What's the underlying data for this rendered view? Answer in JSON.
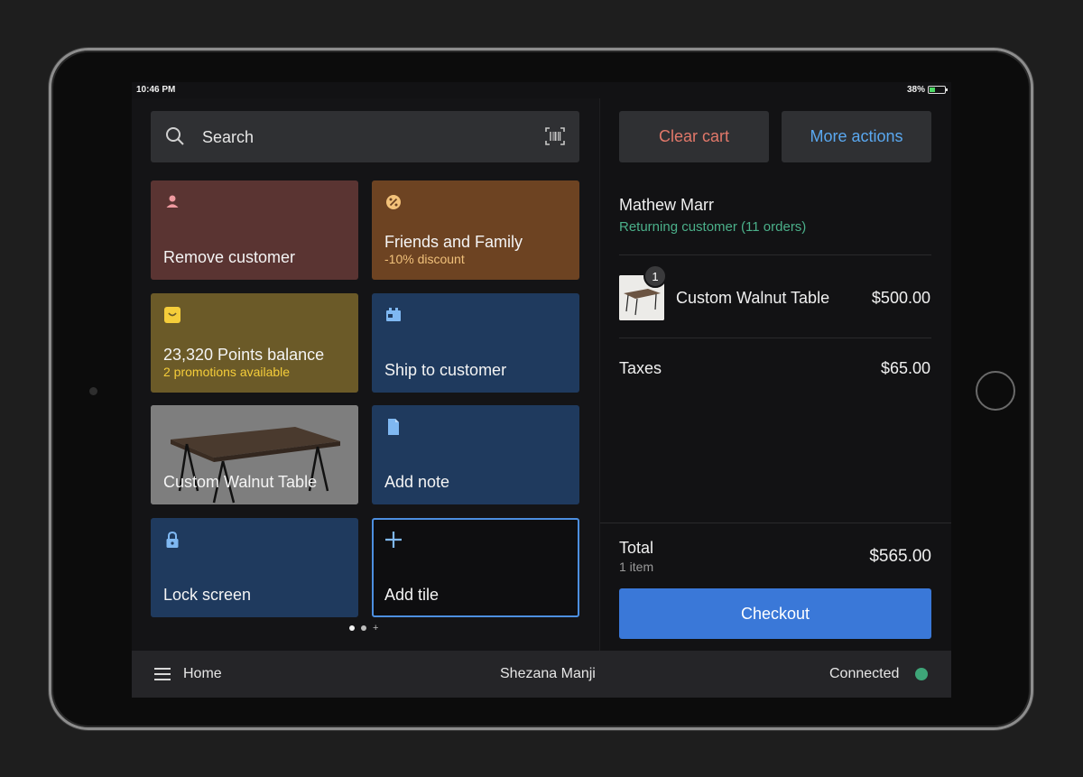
{
  "status_bar": {
    "time": "10:46 PM",
    "battery": "38%"
  },
  "search": {
    "placeholder": "Search"
  },
  "tiles": [
    {
      "label": "Remove customer",
      "sub": "",
      "icon": "person-icon"
    },
    {
      "label": "Friends and Family",
      "sub": "-10% discount",
      "icon": "discount-icon"
    },
    {
      "label": "23,320 Points balance",
      "sub": "2 promotions available",
      "icon": "reward-icon"
    },
    {
      "label": "Ship to customer",
      "sub": "",
      "icon": "shipping-icon"
    },
    {
      "label": "Custom Walnut Table",
      "sub": "",
      "icon": "table-image"
    },
    {
      "label": "Add note",
      "sub": "",
      "icon": "note-icon"
    },
    {
      "label": "Lock screen",
      "sub": "",
      "icon": "lock-icon"
    },
    {
      "label": "Add tile",
      "sub": "",
      "icon": "plus-icon"
    }
  ],
  "cart": {
    "clear_label": "Clear cart",
    "more_label": "More actions",
    "customer_name": "Mathew Marr",
    "customer_status": "Returning customer (11 orders)",
    "items": [
      {
        "quantity": "1",
        "name": "Custom Walnut Table",
        "price": "$500.00"
      }
    ],
    "taxes_label": "Taxes",
    "taxes_value": "$65.00",
    "total_label": "Total",
    "total_count": "1 item",
    "total_value": "$565.00",
    "checkout_label": "Checkout"
  },
  "bottom_bar": {
    "home_label": "Home",
    "user": "Shezana Manji",
    "connection": "Connected"
  },
  "colors": {
    "accent": "#3a78d8",
    "clear": "#e2786a",
    "more": "#5aa8f0",
    "returning": "#4bb08a",
    "connected": "#3ea578"
  }
}
